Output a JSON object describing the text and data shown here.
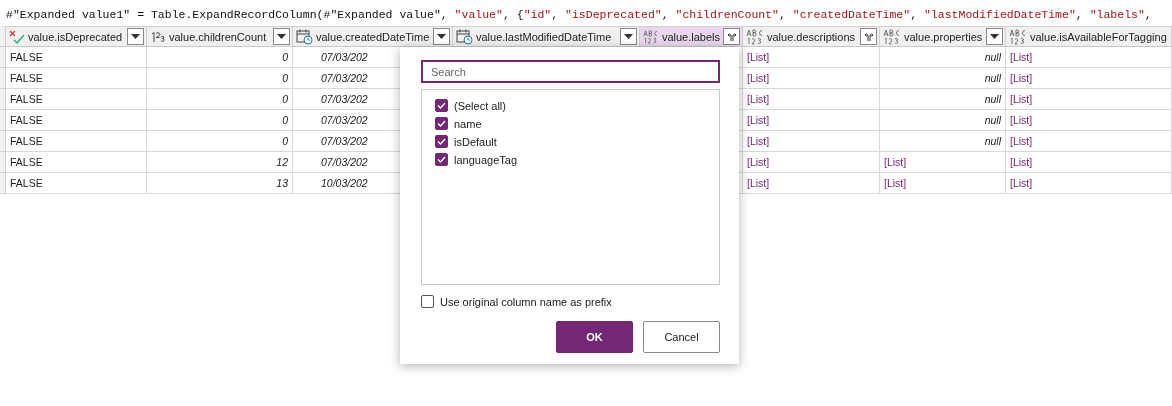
{
  "formula_bar": {
    "text": "#\"Expanded value1\" = Table.ExpandRecordColumn(#\"Expanded value\", \"value\", {\"id\", \"isDeprecated\", \"childrenCount\", \"createdDateTime\", \"lastModifiedDateTime\", \"labels\","
  },
  "table": {
    "columns": [
      {
        "name": "value.isDeprecated",
        "kind": "logical",
        "expandable": false,
        "selected": false
      },
      {
        "name": "value.childrenCount",
        "kind": "whole",
        "expandable": false,
        "selected": false
      },
      {
        "name": "value.createdDateTime",
        "kind": "datetime",
        "expandable": false,
        "selected": false
      },
      {
        "name": "value.lastModifiedDateTime",
        "kind": "datetime",
        "expandable": false,
        "selected": false
      },
      {
        "name": "value.labels",
        "kind": "any",
        "expandable": true,
        "selected": true
      },
      {
        "name": "value.descriptions",
        "kind": "any",
        "expandable": true,
        "selected": false
      },
      {
        "name": "value.properties",
        "kind": "any",
        "expandable": false,
        "selected": false
      },
      {
        "name": "value.isAvailableForTagging",
        "kind": "any",
        "selected": false
      }
    ],
    "rows": [
      {
        "is_deprecated": "FALSE",
        "children_count": "0",
        "created": "07/03/202",
        "descriptions": "[List]",
        "properties": {
          "kind": "null",
          "text": "null"
        },
        "available_for_tagging": "[List]"
      },
      {
        "is_deprecated": "FALSE",
        "children_count": "0",
        "created": "07/03/202",
        "descriptions": "[List]",
        "properties": {
          "kind": "null",
          "text": "null"
        },
        "available_for_tagging": "[List]"
      },
      {
        "is_deprecated": "FALSE",
        "children_count": "0",
        "created": "07/03/202",
        "descriptions": "[List]",
        "properties": {
          "kind": "null",
          "text": "null"
        },
        "available_for_tagging": "[List]"
      },
      {
        "is_deprecated": "FALSE",
        "children_count": "0",
        "created": "07/03/202",
        "descriptions": "[List]",
        "properties": {
          "kind": "null",
          "text": "null"
        },
        "available_for_tagging": "[List]"
      },
      {
        "is_deprecated": "FALSE",
        "children_count": "0",
        "created": "07/03/202",
        "descriptions": "[List]",
        "properties": {
          "kind": "null",
          "text": "null"
        },
        "available_for_tagging": "[List]"
      },
      {
        "is_deprecated": "FALSE",
        "children_count": "12",
        "created": "07/03/202",
        "descriptions": "[List]",
        "properties": {
          "kind": "list",
          "text": "[List]"
        },
        "available_for_tagging": "[List]"
      },
      {
        "is_deprecated": "FALSE",
        "children_count": "13",
        "created": "10/03/202",
        "descriptions": "[List]",
        "properties": {
          "kind": "list",
          "text": "[List]"
        },
        "available_for_tagging": "[List]"
      }
    ]
  },
  "expand_popup": {
    "search": {
      "placeholder": "Search"
    },
    "items": [
      {
        "label": "(Select all)",
        "checked": true
      },
      {
        "label": "name",
        "checked": true
      },
      {
        "label": "isDefault",
        "checked": true
      },
      {
        "label": "languageTag",
        "checked": true
      }
    ],
    "prefix_option": {
      "label": "Use original column name as prefix",
      "checked": false
    },
    "buttons": [
      {
        "label": "OK",
        "kind": "primary"
      },
      {
        "label": "Cancel",
        "kind": "secondary"
      }
    ]
  }
}
